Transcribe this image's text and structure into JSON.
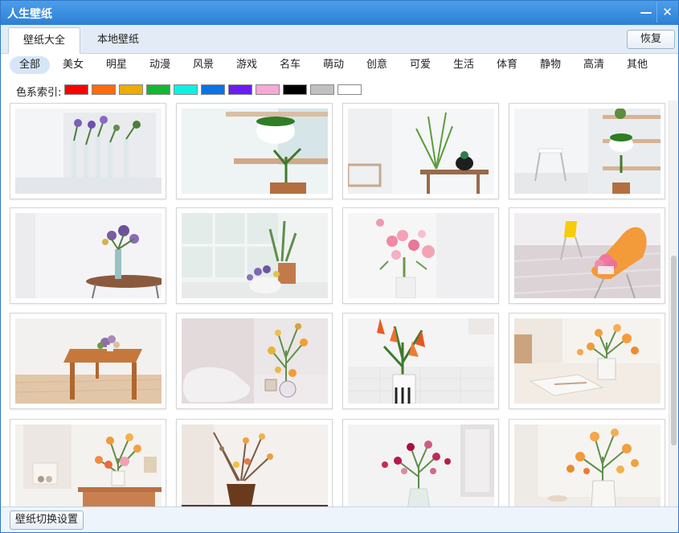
{
  "window": {
    "title": "人生壁纸",
    "minimize_glyph": "—",
    "close_glyph": "✕"
  },
  "tabs": [
    {
      "label": "壁纸大全",
      "active": true
    },
    {
      "label": "本地壁纸",
      "active": false
    }
  ],
  "restore_label": "恢复",
  "categories": [
    {
      "label": "全部",
      "active": true
    },
    {
      "label": "美女"
    },
    {
      "label": "明星"
    },
    {
      "label": "动漫"
    },
    {
      "label": "风景"
    },
    {
      "label": "游戏"
    },
    {
      "label": "名车"
    },
    {
      "label": "萌动"
    },
    {
      "label": "创意"
    },
    {
      "label": "可爱"
    },
    {
      "label": "生活"
    },
    {
      "label": "体育"
    },
    {
      "label": "静物"
    },
    {
      "label": "高清"
    },
    {
      "label": "其他"
    }
  ],
  "color_index": {
    "label": "色系索引:",
    "swatches": [
      {
        "name": "red",
        "color": "#ff0000"
      },
      {
        "name": "orange",
        "color": "#ff6a0e"
      },
      {
        "name": "yellow",
        "color": "#ecac00"
      },
      {
        "name": "green",
        "color": "#14b830"
      },
      {
        "name": "cyan",
        "color": "#10f0e2"
      },
      {
        "name": "blue",
        "color": "#0b73e8"
      },
      {
        "name": "purple",
        "color": "#6a1cf2"
      },
      {
        "name": "pink",
        "color": "#f7a9d3"
      },
      {
        "name": "black",
        "color": "#000000"
      },
      {
        "name": "gray",
        "color": "#c0c0c0"
      },
      {
        "name": "white",
        "color": "#ffffff"
      }
    ]
  },
  "wallpapers": [
    {
      "subject": "purple-flowers-in-glass-vases"
    },
    {
      "subject": "potted-plants-on-shelves"
    },
    {
      "subject": "grass-and-black-vase-on-table"
    },
    {
      "subject": "white-chair-and-plant-shelves"
    },
    {
      "subject": "purple-flower-vase-on-table"
    },
    {
      "subject": "flowers-by-window"
    },
    {
      "subject": "pink-flower-bouquet"
    },
    {
      "subject": "orange-chair-with-flowers"
    },
    {
      "subject": "wooden-table-in-room"
    },
    {
      "subject": "white-sofa-and-yellow-flowers"
    },
    {
      "subject": "orange-lilies-in-vase"
    },
    {
      "subject": "orange-flowers-and-open-book"
    },
    {
      "subject": "flower-arrangement-on-wooden-bench"
    },
    {
      "subject": "branches-in-brown-vase"
    },
    {
      "subject": "red-flowers-in-glass-vase"
    },
    {
      "subject": "orange-flowers-in-white-jug"
    }
  ],
  "scroll_position": 0.38,
  "footer": {
    "settings_label": "壁纸切换设置"
  }
}
